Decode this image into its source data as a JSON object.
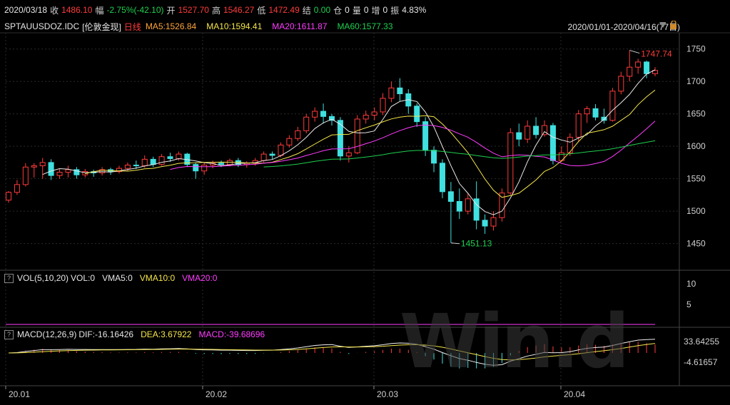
{
  "header": {
    "date": "2020/03/18",
    "close_label": "收",
    "close_value": "1486.10",
    "change_label": "幅",
    "change_value": "-2.75%(-42.10)",
    "open_label": "开",
    "open_value": "1527.70",
    "high_label": "高",
    "high_value": "1546.27",
    "low_label": "低",
    "low_value": "1472.49",
    "settle_label": "结",
    "settle_value": "0.00",
    "oi_label": "仓",
    "oi_value": "0",
    "vol_label": "量",
    "vol_value": "0",
    "incr_label": "增",
    "incr_value": "0",
    "amp_label": "振",
    "amp_value": "4.83%"
  },
  "legend": {
    "symbol": "SPTAUUSDOZ.IDC",
    "name": "[伦敦金现]",
    "period": "日线",
    "ma5": "MA5:1526.84",
    "ma10": "MA10:1594.41",
    "ma20": "MA20:1611.87",
    "ma60": "MA60:1577.33",
    "range": "2020/01/01-2020/04/16(77日)"
  },
  "annotations": {
    "high": "1747.74",
    "low": "1451.13"
  },
  "vol_panel": {
    "q": "?",
    "title": "VOL(5,10,20)",
    "vol": "VOL:0",
    "vma5": "VMA5:0",
    "vma10": "VMA10:0",
    "vma20": "VMA20:0",
    "ticks": [
      "10",
      "5"
    ]
  },
  "macd_panel": {
    "q": "?",
    "title": "MACD(12,26,9)",
    "dif": "DIF:-16.16426",
    "dea": "DEA:3.67922",
    "macd": "MACD:-39.68696",
    "ticks": [
      "33.64255",
      "-4.61657"
    ]
  },
  "watermark": "Win.d",
  "colors": {
    "up": "#ff3b3b",
    "down": "#40e0e0",
    "ma5": "#e8e8e8",
    "ma10": "#f5e64a",
    "ma20": "#ff3cff",
    "ma60": "#1fcf4f",
    "grid": "#2a2a2a"
  },
  "chart_data": {
    "type": "candlestick",
    "title": "SPTAUUSDOZ.IDC [伦敦金现] 日线",
    "y_ticks": [
      "1750",
      "1700",
      "1650",
      "1600",
      "1550",
      "1500",
      "1450"
    ],
    "x_ticks": [
      "20.01",
      "20.02",
      "20.03",
      "20.04"
    ],
    "ylim": [
      1410,
      1775
    ],
    "candles": [
      [
        1517,
        1529,
        1513,
        1531
      ],
      [
        1529,
        1541,
        1525,
        1548
      ],
      [
        1541,
        1568,
        1538,
        1574
      ],
      [
        1568,
        1570,
        1552,
        1574
      ],
      [
        1570,
        1575,
        1550,
        1582
      ],
      [
        1575,
        1555,
        1548,
        1580
      ],
      [
        1555,
        1560,
        1550,
        1565
      ],
      [
        1560,
        1564,
        1552,
        1570
      ],
      [
        1564,
        1556,
        1550,
        1568
      ],
      [
        1556,
        1561,
        1552,
        1565
      ],
      [
        1561,
        1559,
        1553,
        1564
      ],
      [
        1559,
        1564,
        1555,
        1568
      ],
      [
        1564,
        1561,
        1556,
        1567
      ],
      [
        1561,
        1566,
        1558,
        1570
      ],
      [
        1566,
        1571,
        1562,
        1575
      ],
      [
        1571,
        1570,
        1565,
        1578
      ],
      [
        1570,
        1580,
        1567,
        1586
      ],
      [
        1580,
        1572,
        1568,
        1584
      ],
      [
        1572,
        1584,
        1570,
        1588
      ],
      [
        1584,
        1581,
        1576,
        1590
      ],
      [
        1581,
        1588,
        1578,
        1592
      ],
      [
        1588,
        1572,
        1568,
        1590
      ],
      [
        1572,
        1562,
        1550,
        1575
      ],
      [
        1562,
        1571,
        1556,
        1575
      ],
      [
        1571,
        1574,
        1566,
        1578
      ],
      [
        1574,
        1572,
        1568,
        1578
      ],
      [
        1572,
        1578,
        1569,
        1581
      ],
      [
        1578,
        1572,
        1568,
        1582
      ],
      [
        1572,
        1574,
        1567,
        1577
      ],
      [
        1574,
        1578,
        1570,
        1582
      ],
      [
        1578,
        1588,
        1575,
        1592
      ],
      [
        1588,
        1586,
        1580,
        1592
      ],
      [
        1586,
        1602,
        1583,
        1606
      ],
      [
        1602,
        1612,
        1598,
        1617
      ],
      [
        1612,
        1624,
        1608,
        1630
      ],
      [
        1624,
        1645,
        1620,
        1650
      ],
      [
        1645,
        1654,
        1638,
        1660
      ],
      [
        1654,
        1646,
        1635,
        1666
      ],
      [
        1646,
        1640,
        1632,
        1650
      ],
      [
        1640,
        1585,
        1578,
        1645
      ],
      [
        1585,
        1590,
        1575,
        1600
      ],
      [
        1590,
        1642,
        1588,
        1648
      ],
      [
        1642,
        1648,
        1635,
        1655
      ],
      [
        1648,
        1653,
        1640,
        1660
      ],
      [
        1653,
        1674,
        1648,
        1682
      ],
      [
        1674,
        1690,
        1668,
        1700
      ],
      [
        1690,
        1681,
        1670,
        1705
      ],
      [
        1681,
        1662,
        1650,
        1688
      ],
      [
        1662,
        1638,
        1630,
        1666
      ],
      [
        1638,
        1594,
        1585,
        1645
      ],
      [
        1594,
        1574,
        1560,
        1600
      ],
      [
        1574,
        1530,
        1520,
        1580
      ],
      [
        1530,
        1515,
        1451,
        1545
      ],
      [
        1515,
        1500,
        1488,
        1535
      ],
      [
        1500,
        1519,
        1495,
        1528
      ],
      [
        1519,
        1486,
        1472,
        1546
      ],
      [
        1486,
        1477,
        1465,
        1495
      ],
      [
        1477,
        1490,
        1470,
        1500
      ],
      [
        1490,
        1528,
        1484,
        1535
      ],
      [
        1528,
        1621,
        1525,
        1628
      ],
      [
        1621,
        1611,
        1600,
        1635
      ],
      [
        1611,
        1631,
        1605,
        1640
      ],
      [
        1631,
        1618,
        1612,
        1645
      ],
      [
        1618,
        1632,
        1615,
        1640
      ],
      [
        1632,
        1578,
        1572,
        1636
      ],
      [
        1578,
        1590,
        1576,
        1600
      ],
      [
        1590,
        1614,
        1585,
        1620
      ],
      [
        1614,
        1650,
        1608,
        1656
      ],
      [
        1650,
        1658,
        1636,
        1662
      ],
      [
        1658,
        1645,
        1640,
        1665
      ],
      [
        1645,
        1640,
        1635,
        1658
      ],
      [
        1640,
        1685,
        1638,
        1690
      ],
      [
        1685,
        1708,
        1680,
        1715
      ],
      [
        1708,
        1722,
        1700,
        1748
      ],
      [
        1722,
        1730,
        1712,
        1735
      ],
      [
        1730,
        1712,
        1705,
        1732
      ],
      [
        1712,
        1717,
        1708,
        1722
      ]
    ],
    "ma5_note": "MA5 1526.84, MA10 1594.41, MA20 1611.87, MA60 1577.33 (values at 2020/03/18)"
  }
}
